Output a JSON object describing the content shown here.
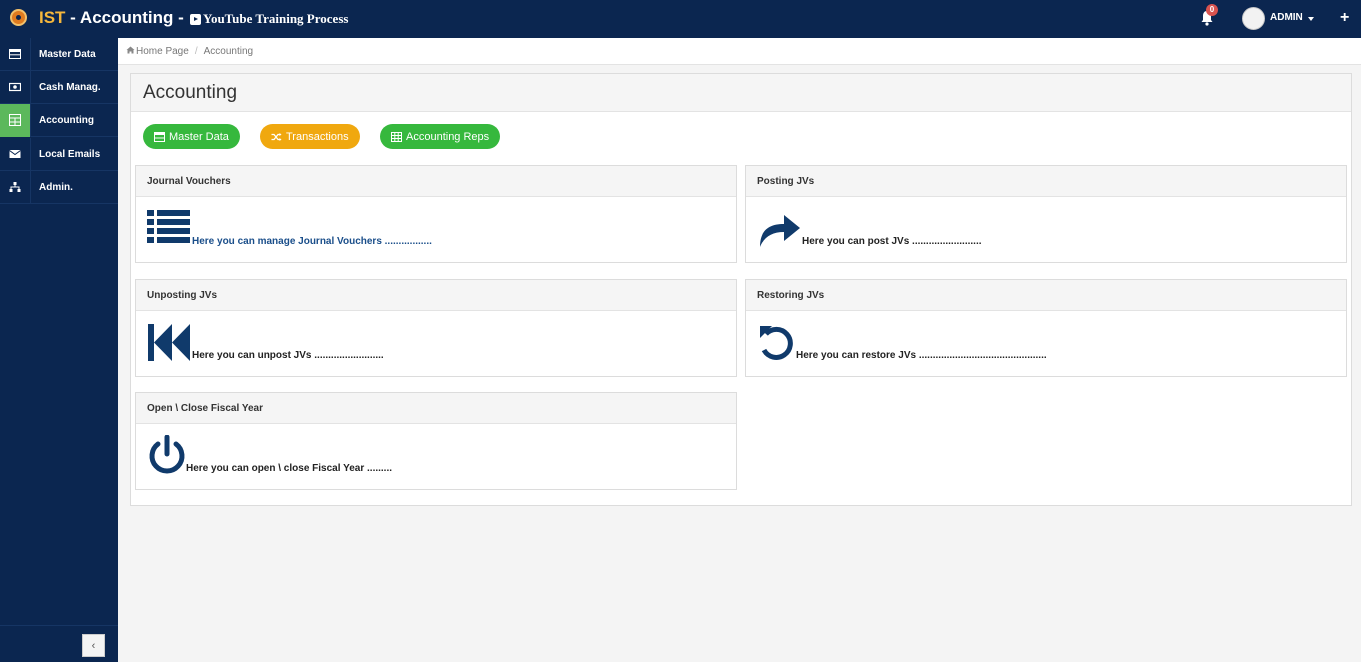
{
  "app": {
    "brand_prefix": "IST",
    "brand_rest": " - Accounting -",
    "youtube_label": "YouTube Training Process"
  },
  "topbar": {
    "notifications_count": "0",
    "user_name": "ADMIN"
  },
  "sidebar": {
    "items": [
      {
        "label": "Master Data",
        "icon": "table-icon"
      },
      {
        "label": "Cash Manag.",
        "icon": "money-icon"
      },
      {
        "label": "Accounting",
        "icon": "grid-icon",
        "active": true
      },
      {
        "label": "Local Emails",
        "icon": "envelope-icon"
      },
      {
        "label": "Admin.",
        "icon": "sitemap-icon"
      }
    ]
  },
  "breadcrumb": {
    "home": "Home Page",
    "current": "Accounting"
  },
  "page": {
    "title": "Accounting",
    "buttons": [
      {
        "label": "Master Data",
        "icon": "table-icon",
        "color": "#36b83d"
      },
      {
        "label": "Transactions",
        "icon": "random-icon",
        "color": "#f0a80f"
      },
      {
        "label": "Accounting Reps",
        "icon": "th-icon",
        "color": "#36b83d"
      }
    ]
  },
  "cards": [
    {
      "title": "Journal Vouchers",
      "text": "Here you can manage Journal Vouchers .................",
      "icon": "list-icon"
    },
    {
      "title": "Posting JVs",
      "text": "Here you can post JVs .........................",
      "icon": "share-arrow-icon"
    },
    {
      "title": "Unposting JVs",
      "text": "Here you can unpost JVs .........................",
      "icon": "fast-backward-icon"
    },
    {
      "title": "Restoring JVs",
      "text": "Here you can restore JVs ..............................................",
      "icon": "undo-icon"
    },
    {
      "title": "Open \\ Close Fiscal Year",
      "text": "Here you can open \\ close Fiscal Year .........",
      "icon": "power-icon"
    }
  ],
  "colors": {
    "navy": "#0b2650",
    "icon_blue": "#103a6b",
    "active_green": "#5cb85c"
  }
}
